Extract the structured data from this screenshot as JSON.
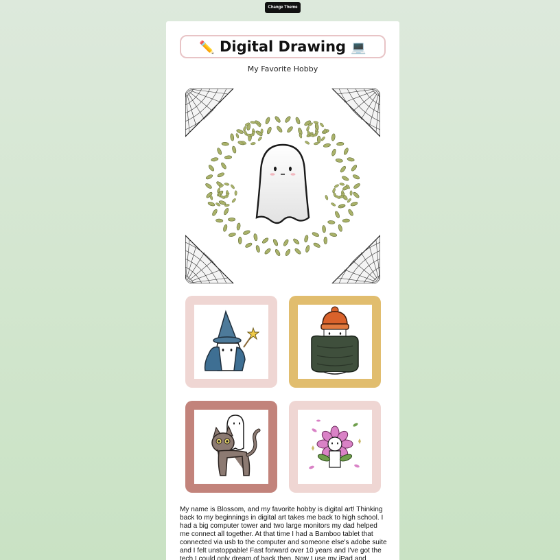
{
  "header": {
    "theme_button_label": "Change Theme"
  },
  "title": {
    "left_emoji": "✏️",
    "text": "Digital Drawing",
    "right_emoji": "💻"
  },
  "subtitle": "My Favorite Hobby",
  "gallery": {
    "hero_icon": "ghost-wreath-cobweb-illustration",
    "thumbnails": [
      {
        "icon": "wizard-ghost-illustration",
        "frame_color": "#efd6d3"
      },
      {
        "icon": "winter-ghost-illustration",
        "frame_color": "#e1bd6e"
      },
      {
        "icon": "cat-ghost-illustration",
        "frame_color": "#c2837b"
      },
      {
        "icon": "flower-ghost-illustration",
        "frame_color": "#efd6d3"
      }
    ]
  },
  "bio": {
    "text": "My name is Blossom, and my favorite hobby is digital art! Thinking back to my beginnings in digital art takes me back to high school. I had a big computer tower and two large monitors my dad helped me connect all together. At that time I had a Bamboo tablet that connected via usb to the computer and someone else's adobe suite and I felt unstoppable! Fast forward over 10 years and I've got the tech I could only dream of back then. Now I use my iPad and"
  },
  "colors": {
    "background_top": "#dde9dc",
    "background_bottom": "#c9e2c4",
    "card": "#ffffff",
    "title_border": "#e8c4c6",
    "button_bg": "#111111"
  }
}
